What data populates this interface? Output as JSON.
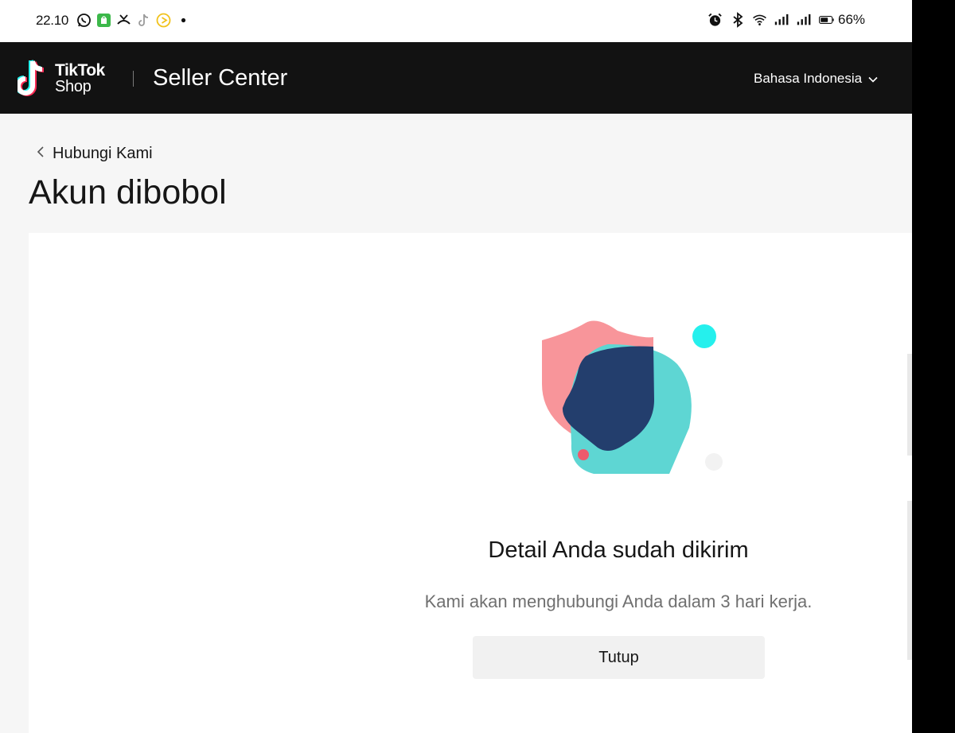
{
  "status_bar": {
    "time": "22.10",
    "left_icons": [
      "whatsapp-icon",
      "shop-app-icon",
      "missed-call-icon",
      "tiktok-icon",
      "play-icon",
      "dot-icon"
    ],
    "right_icons": [
      "alarm-icon",
      "bluetooth-icon",
      "wifi-icon",
      "signal-icon",
      "signal-icon",
      "battery-icon"
    ],
    "battery_percent": "66%"
  },
  "header": {
    "logo_line1": "TikTok",
    "logo_line2": "Shop",
    "app_title": "Seller Center",
    "language": "Bahasa Indonesia"
  },
  "breadcrumb": {
    "back_label": "Hubungi Kami"
  },
  "page": {
    "title": "Akun dibobol"
  },
  "result": {
    "title": "Detail Anda sudah dikirim",
    "subtitle": "Kami akan menghubungi Anda dalam 3 hari kerja.",
    "close_label": "Tutup"
  },
  "colors": {
    "header_bg": "#121212",
    "shield_pink": "#f8959a",
    "shield_teal": "#5ed6d3",
    "head_navy": "#233e6d",
    "dot_cyan": "#25f0ed",
    "dot_red": "#ee5a6d"
  }
}
